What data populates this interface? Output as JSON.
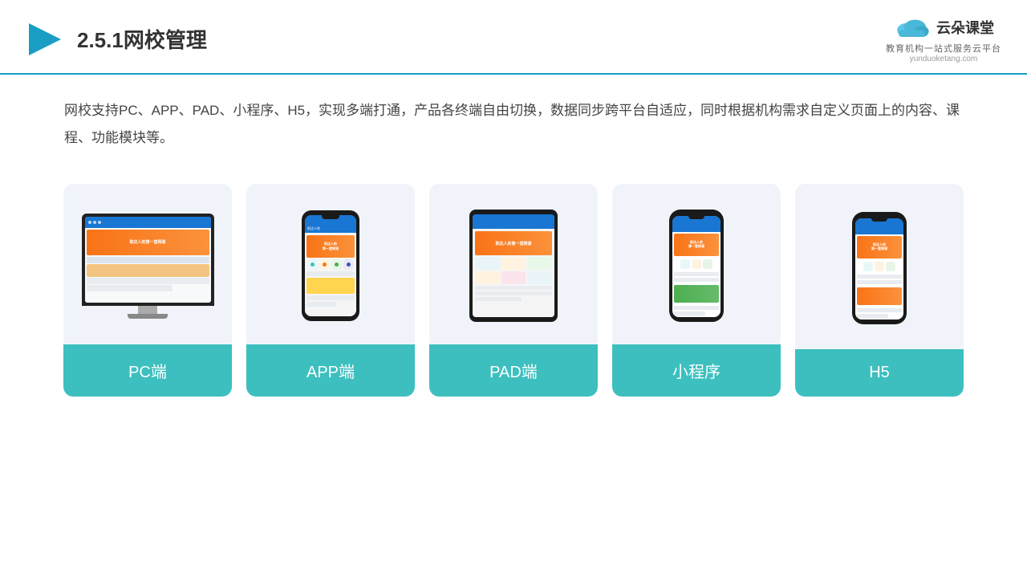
{
  "header": {
    "title_prefix": "2.5.1",
    "title_main": "网校管理",
    "logo_name": "云朵课堂",
    "logo_url": "yunduoketang.com",
    "logo_tagline": "教育机构一站\n式服务云平台"
  },
  "description": {
    "text": "网校支持PC、APP、PAD、小程序、H5，实现多端打通，产品各终端自由切换，数据同步跨平台自适应，同时根据机构需求自定义页面上的内容、课程、功能模块等。"
  },
  "cards": [
    {
      "id": "pc",
      "label": "PC端"
    },
    {
      "id": "app",
      "label": "APP端"
    },
    {
      "id": "pad",
      "label": "PAD端"
    },
    {
      "id": "miniprogram",
      "label": "小程序"
    },
    {
      "id": "h5",
      "label": "H5"
    }
  ],
  "colors": {
    "card_label_bg": "#3dbfbf",
    "header_border": "#1a9dc3",
    "primary_blue": "#1976d2",
    "orange": "#f97316"
  }
}
